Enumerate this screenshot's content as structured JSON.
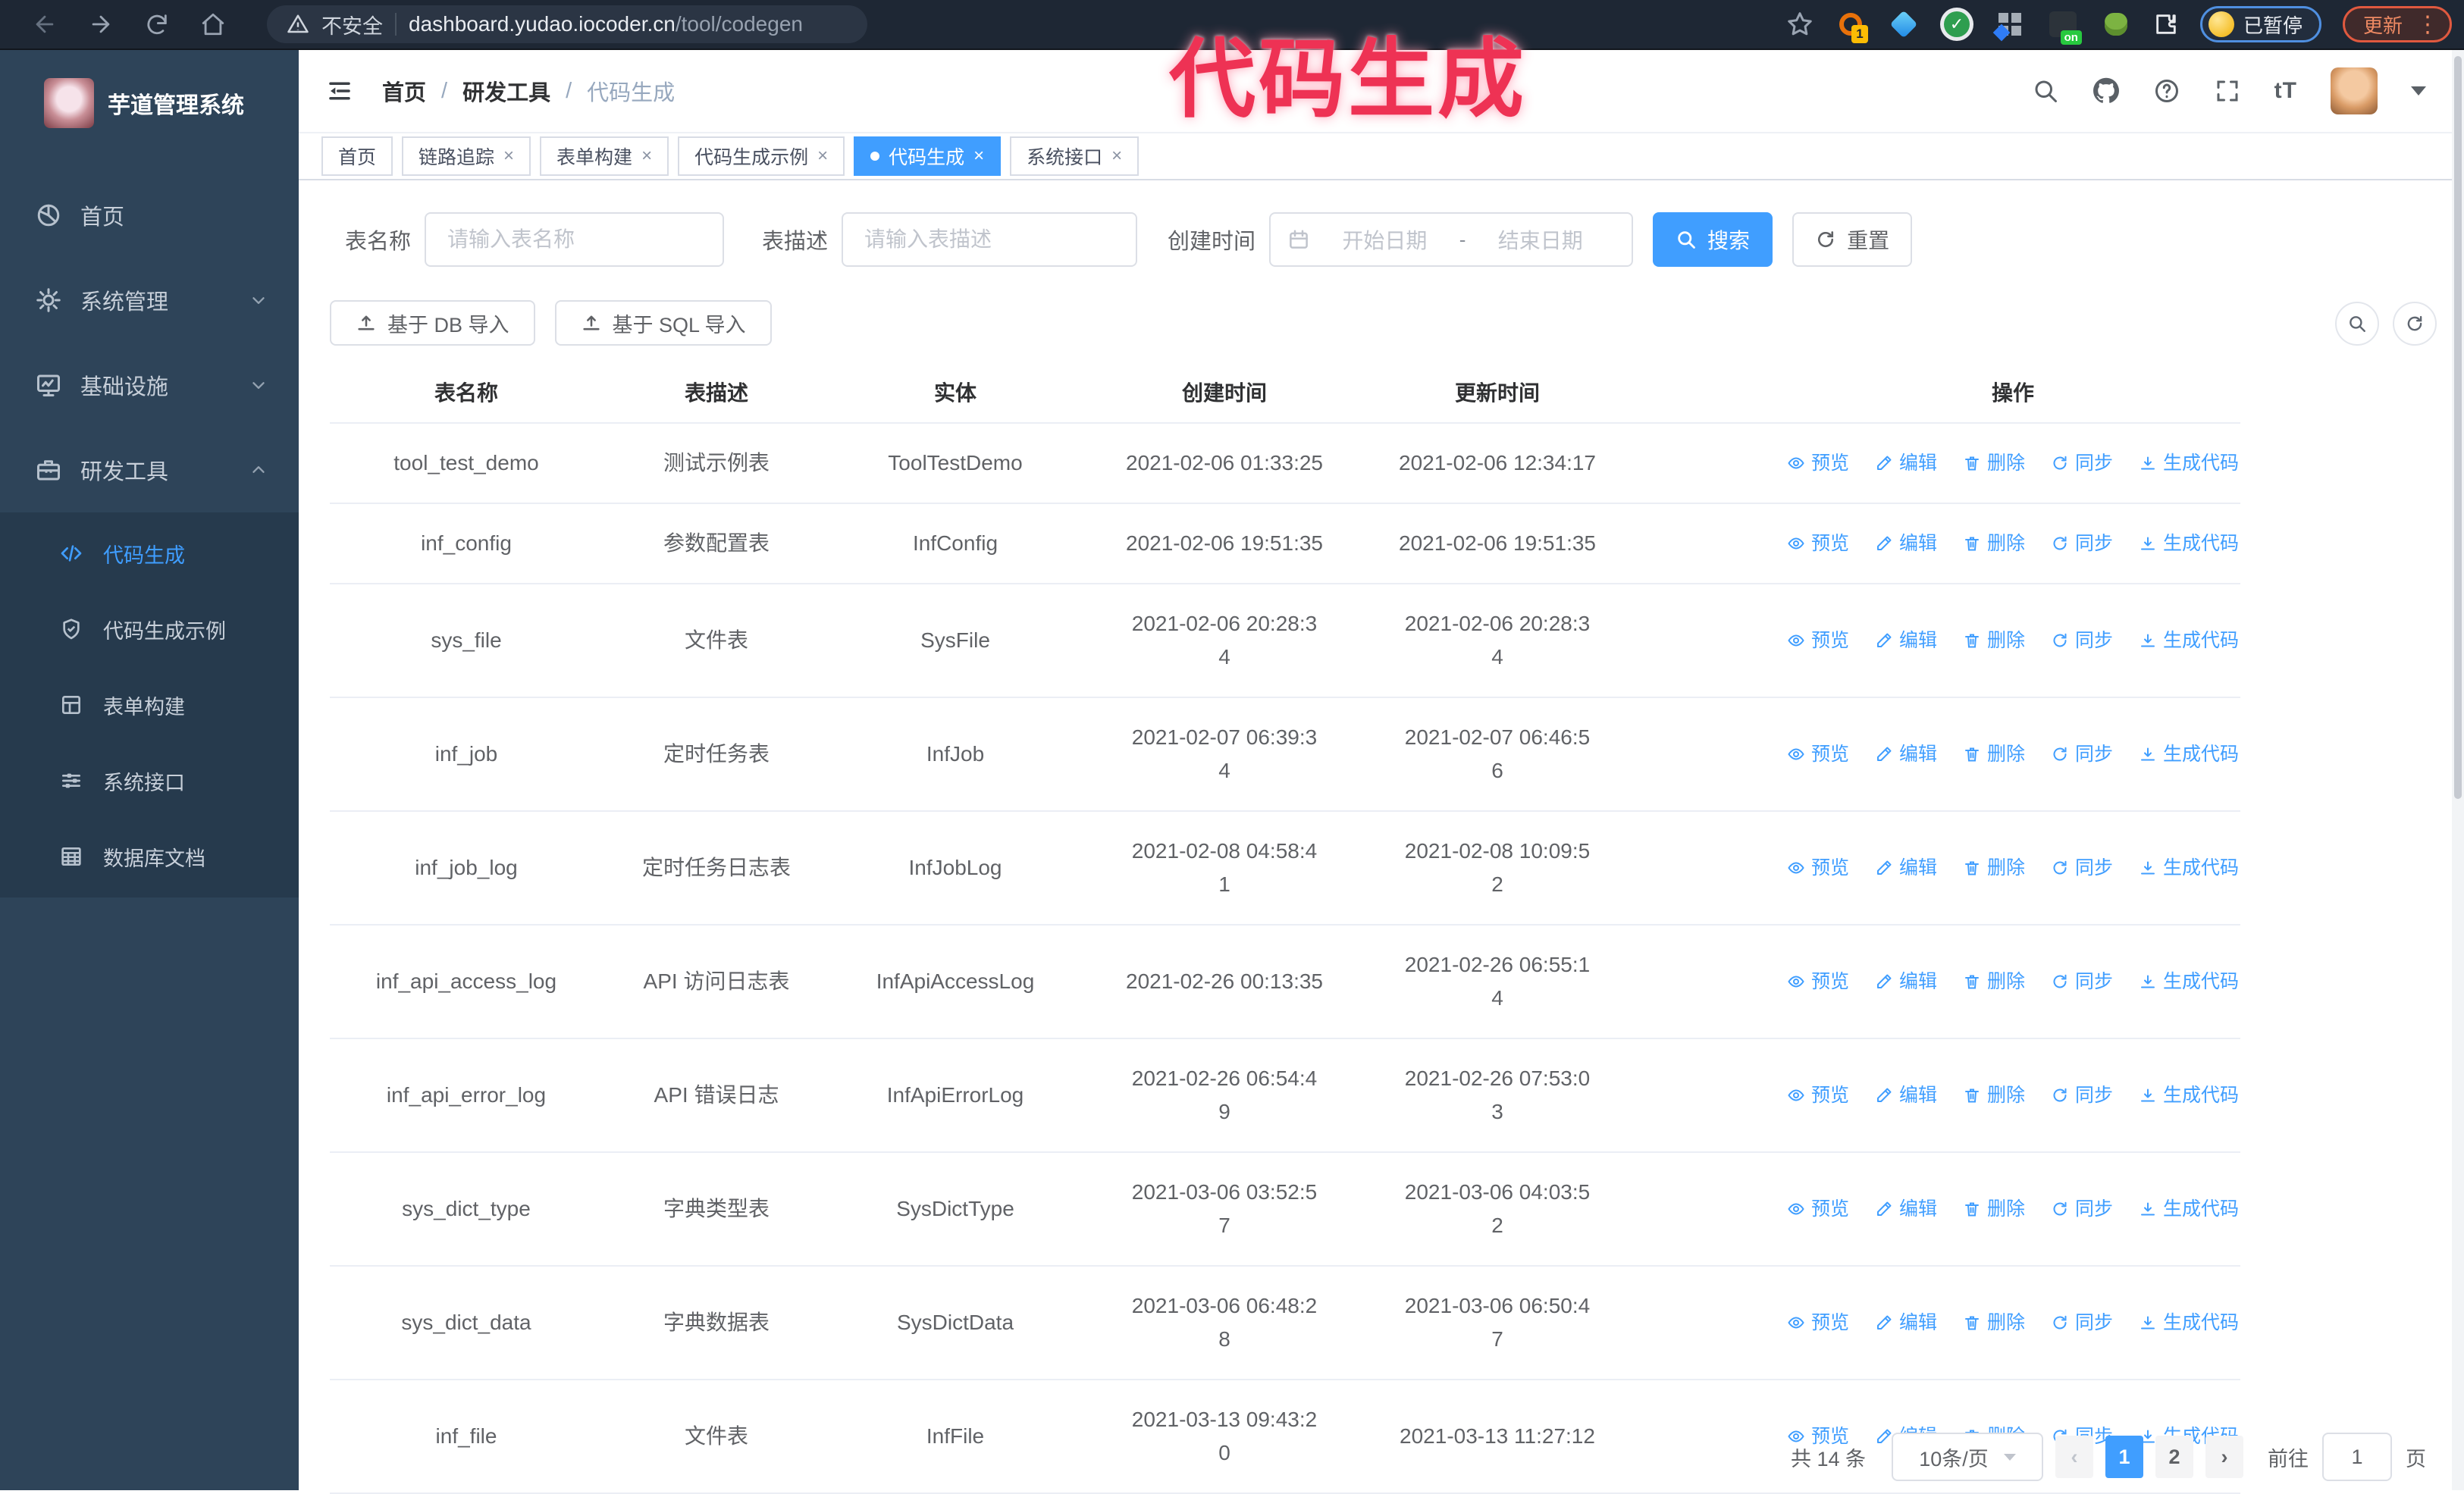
{
  "browser": {
    "security_label": "不安全",
    "url_host": "dashboard.yudao.iocoder.cn",
    "url_path": "/tool/codegen",
    "ext_badge_count": "1",
    "ext_badge_on": "on",
    "paused_badge": "已暂停",
    "update_button": "更新"
  },
  "annotation": {
    "text": "代码生成",
    "color": "#ee3254"
  },
  "sidebar": {
    "app_title": "芋道管理系统",
    "menu": [
      {
        "id": "home",
        "label": "首页",
        "icon": "dashboard-icon",
        "chevron": "none"
      },
      {
        "id": "system",
        "label": "系统管理",
        "icon": "gear-icon",
        "chevron": "down"
      },
      {
        "id": "infra",
        "label": "基础设施",
        "icon": "monitor-icon",
        "chevron": "down"
      },
      {
        "id": "devtools",
        "label": "研发工具",
        "icon": "toolbox-icon",
        "chevron": "up"
      }
    ],
    "submenu": [
      {
        "id": "codegen",
        "label": "代码生成",
        "icon": "code-icon",
        "active": true
      },
      {
        "id": "codegen-example",
        "label": "代码生成示例",
        "icon": "badge-icon",
        "active": false
      },
      {
        "id": "form-builder",
        "label": "表单构建",
        "icon": "form-icon",
        "active": false
      },
      {
        "id": "api",
        "label": "系统接口",
        "icon": "sliders-icon",
        "active": false
      },
      {
        "id": "db-doc",
        "label": "数据库文档",
        "icon": "dbdoc-icon",
        "active": false
      }
    ]
  },
  "header": {
    "breadcrumb": [
      "首页",
      "研发工具",
      "代码生成"
    ],
    "separator": "/"
  },
  "tabs": [
    {
      "id": "home",
      "label": "首页",
      "closable": false,
      "active": false
    },
    {
      "id": "tracer",
      "label": "链路追踪",
      "closable": true,
      "active": false
    },
    {
      "id": "form-builder",
      "label": "表单构建",
      "closable": true,
      "active": false
    },
    {
      "id": "codegen-example",
      "label": "代码生成示例",
      "closable": true,
      "active": false
    },
    {
      "id": "codegen",
      "label": "代码生成",
      "closable": true,
      "active": true
    },
    {
      "id": "api",
      "label": "系统接口",
      "closable": true,
      "active": false
    }
  ],
  "filters": {
    "table_name_label": "表名称",
    "table_name_placeholder": "请输入表名称",
    "table_desc_label": "表描述",
    "table_desc_placeholder": "请输入表描述",
    "create_time_label": "创建时间",
    "date_start_placeholder": "开始日期",
    "date_separator": "-",
    "date_end_placeholder": "结束日期",
    "search_button": "搜索",
    "reset_button": "重置"
  },
  "toolbar": {
    "import_db_button": "基于 DB 导入",
    "import_sql_button": "基于 SQL 导入"
  },
  "table": {
    "columns": [
      "表名称",
      "表描述",
      "实体",
      "创建时间",
      "更新时间",
      "操作"
    ],
    "actions": [
      {
        "id": "preview",
        "label": "预览",
        "icon": "eye-icon"
      },
      {
        "id": "edit",
        "label": "编辑",
        "icon": "pencil-icon"
      },
      {
        "id": "delete",
        "label": "删除",
        "icon": "trash-icon"
      },
      {
        "id": "sync",
        "label": "同步",
        "icon": "sync-icon"
      },
      {
        "id": "generate",
        "label": "生成代码",
        "icon": "download-icon"
      }
    ],
    "rows": [
      {
        "name": "tool_test_demo",
        "desc": "测试示例表",
        "entity": "ToolTestDemo",
        "created": "2021-02-06 01:33:25",
        "updated": "2021-02-06 12:34:17"
      },
      {
        "name": "inf_config",
        "desc": "参数配置表",
        "entity": "InfConfig",
        "created": "2021-02-06 19:51:35",
        "updated": "2021-02-06 19:51:35"
      },
      {
        "name": "sys_file",
        "desc": "文件表",
        "entity": "SysFile",
        "created": "2021-02-06 20:28:3\n4",
        "updated": "2021-02-06 20:28:3\n4"
      },
      {
        "name": "inf_job",
        "desc": "定时任务表",
        "entity": "InfJob",
        "created": "2021-02-07 06:39:3\n4",
        "updated": "2021-02-07 06:46:5\n6"
      },
      {
        "name": "inf_job_log",
        "desc": "定时任务日志表",
        "entity": "InfJobLog",
        "created": "2021-02-08 04:58:4\n1",
        "updated": "2021-02-08 10:09:5\n2"
      },
      {
        "name": "inf_api_access_log",
        "desc": "API 访问日志表",
        "entity": "InfApiAccessLog",
        "created": "2021-02-26 00:13:35",
        "updated": "2021-02-26 06:55:1\n4"
      },
      {
        "name": "inf_api_error_log",
        "desc": "API 错误日志",
        "entity": "InfApiErrorLog",
        "created": "2021-02-26 06:54:4\n9",
        "updated": "2021-02-26 07:53:0\n3"
      },
      {
        "name": "sys_dict_type",
        "desc": "字典类型表",
        "entity": "SysDictType",
        "created": "2021-03-06 03:52:5\n7",
        "updated": "2021-03-06 04:03:5\n2"
      },
      {
        "name": "sys_dict_data",
        "desc": "字典数据表",
        "entity": "SysDictData",
        "created": "2021-03-06 06:48:2\n8",
        "updated": "2021-03-06 06:50:4\n7"
      },
      {
        "name": "inf_file",
        "desc": "文件表",
        "entity": "InfFile",
        "created": "2021-03-13 09:43:2\n0",
        "updated": "2021-03-13 11:27:12"
      }
    ]
  },
  "pagination": {
    "total_text": "共 14 条",
    "page_size": "10条/页",
    "prev_symbol": "‹",
    "next_symbol": "›",
    "pages": [
      "1",
      "2"
    ],
    "current_page": "1",
    "goto_label": "前往",
    "goto_value": "1",
    "goto_suffix": "页"
  }
}
